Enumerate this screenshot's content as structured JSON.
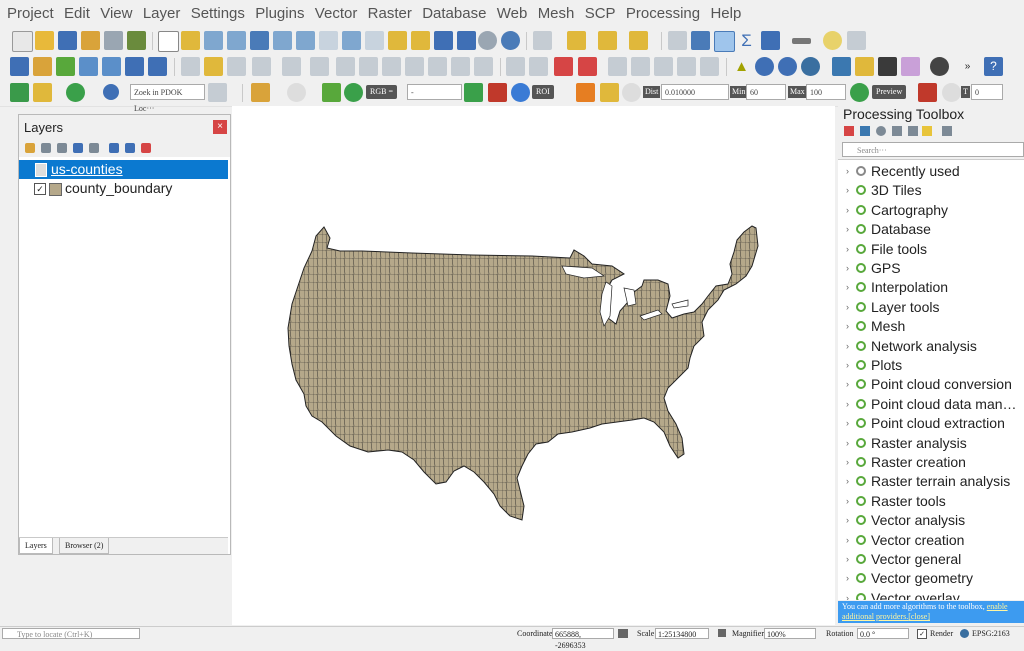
{
  "menu": [
    "Project",
    "Edit",
    "View",
    "Layer",
    "Settings",
    "Plugins",
    "Vector",
    "Raster",
    "Database",
    "Web",
    "Mesh",
    "SCP",
    "Processing",
    "Help"
  ],
  "toolbar3": {
    "search_placeholder": "Zoek in PDOK Loc···",
    "rgb_label": "RGB =",
    "rgb_value": "-",
    "roi_label": "ROI",
    "dist_label": "Dist",
    "dist_value": "0.010000",
    "min_label": "Min",
    "min_value": "60",
    "max_label": "Max",
    "max_value": "100",
    "preview_label": "Preview",
    "t_label": "T",
    "t_value": "0"
  },
  "layers_panel": {
    "title": "Layers",
    "close": "×",
    "items": [
      {
        "name": "us-counties",
        "selected": true,
        "checked": false
      },
      {
        "name": "county_boundary",
        "selected": false,
        "checked": true
      }
    ],
    "tabs": [
      "Layers",
      "Browser (2)"
    ]
  },
  "map": {
    "fill": "#b5a88a",
    "stroke": "#222222"
  },
  "toolbox": {
    "title": "Processing Toolbox",
    "search_placeholder": "Search···",
    "items": [
      "Recently used",
      "3D Tiles",
      "Cartography",
      "Database",
      "File tools",
      "GPS",
      "Interpolation",
      "Layer tools",
      "Mesh",
      "Network analysis",
      "Plots",
      "Point cloud conversion",
      "Point cloud data man…",
      "Point cloud extraction",
      "Raster analysis",
      "Raster creation",
      "Raster terrain analysis",
      "Raster tools",
      "Vector analysis",
      "Vector creation",
      "Vector general",
      "Vector geometry",
      "Vector overlay"
    ],
    "note_text": "You can add more algorithms to the toolbox,",
    "note_link": "enable additional providers.",
    "note_close": "[close]"
  },
  "statusbar": {
    "locate_placeholder": "Type to locate (Ctrl+K)",
    "coordinate_label": "Coordinate",
    "coordinate_value": "665888, -2696353",
    "scale_label": "Scale",
    "scale_value": "1:25134800",
    "magnifier_label": "Magnifier",
    "magnifier_value": "100%",
    "rotation_label": "Rotation",
    "rotation_value": "0.0 °",
    "render_label": "Render",
    "crs": "EPSG:2163"
  },
  "colors": {
    "accent": "#0b79d0",
    "close": "#d64545",
    "qgis_green": "#58a83b",
    "note_bg": "#3d9bf0"
  }
}
